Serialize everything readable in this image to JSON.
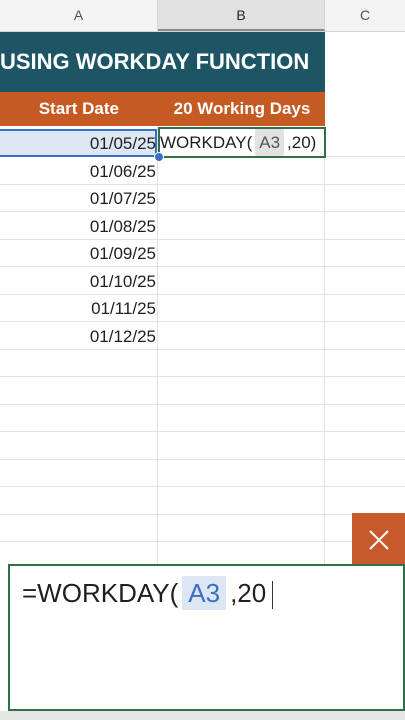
{
  "columns": [
    "A",
    "B",
    "C"
  ],
  "sheet": {
    "title": "USING WORKDAY FUNCTION",
    "header_start": "Start Date",
    "header_days": "20 Working Days",
    "dates": [
      "01/05/25",
      "01/06/25",
      "01/07/25",
      "01/08/25",
      "01/09/25",
      "01/10/25",
      "01/11/25",
      "01/12/25"
    ],
    "b3_formula": {
      "prefix": "WORKDAY(",
      "ref": "A3",
      "suffix": ",20)"
    }
  },
  "formula_bar": {
    "prefix": "=WORKDAY(",
    "ref": "A3",
    "suffix": ",20"
  },
  "cancel_icon": "close-icon",
  "colors": {
    "title_bg": "#1d5565",
    "header_bg": "#c55a22",
    "selection": "#3b6ec4",
    "edit_border": "#2e7148",
    "cancel_bg": "#c65a2d"
  }
}
